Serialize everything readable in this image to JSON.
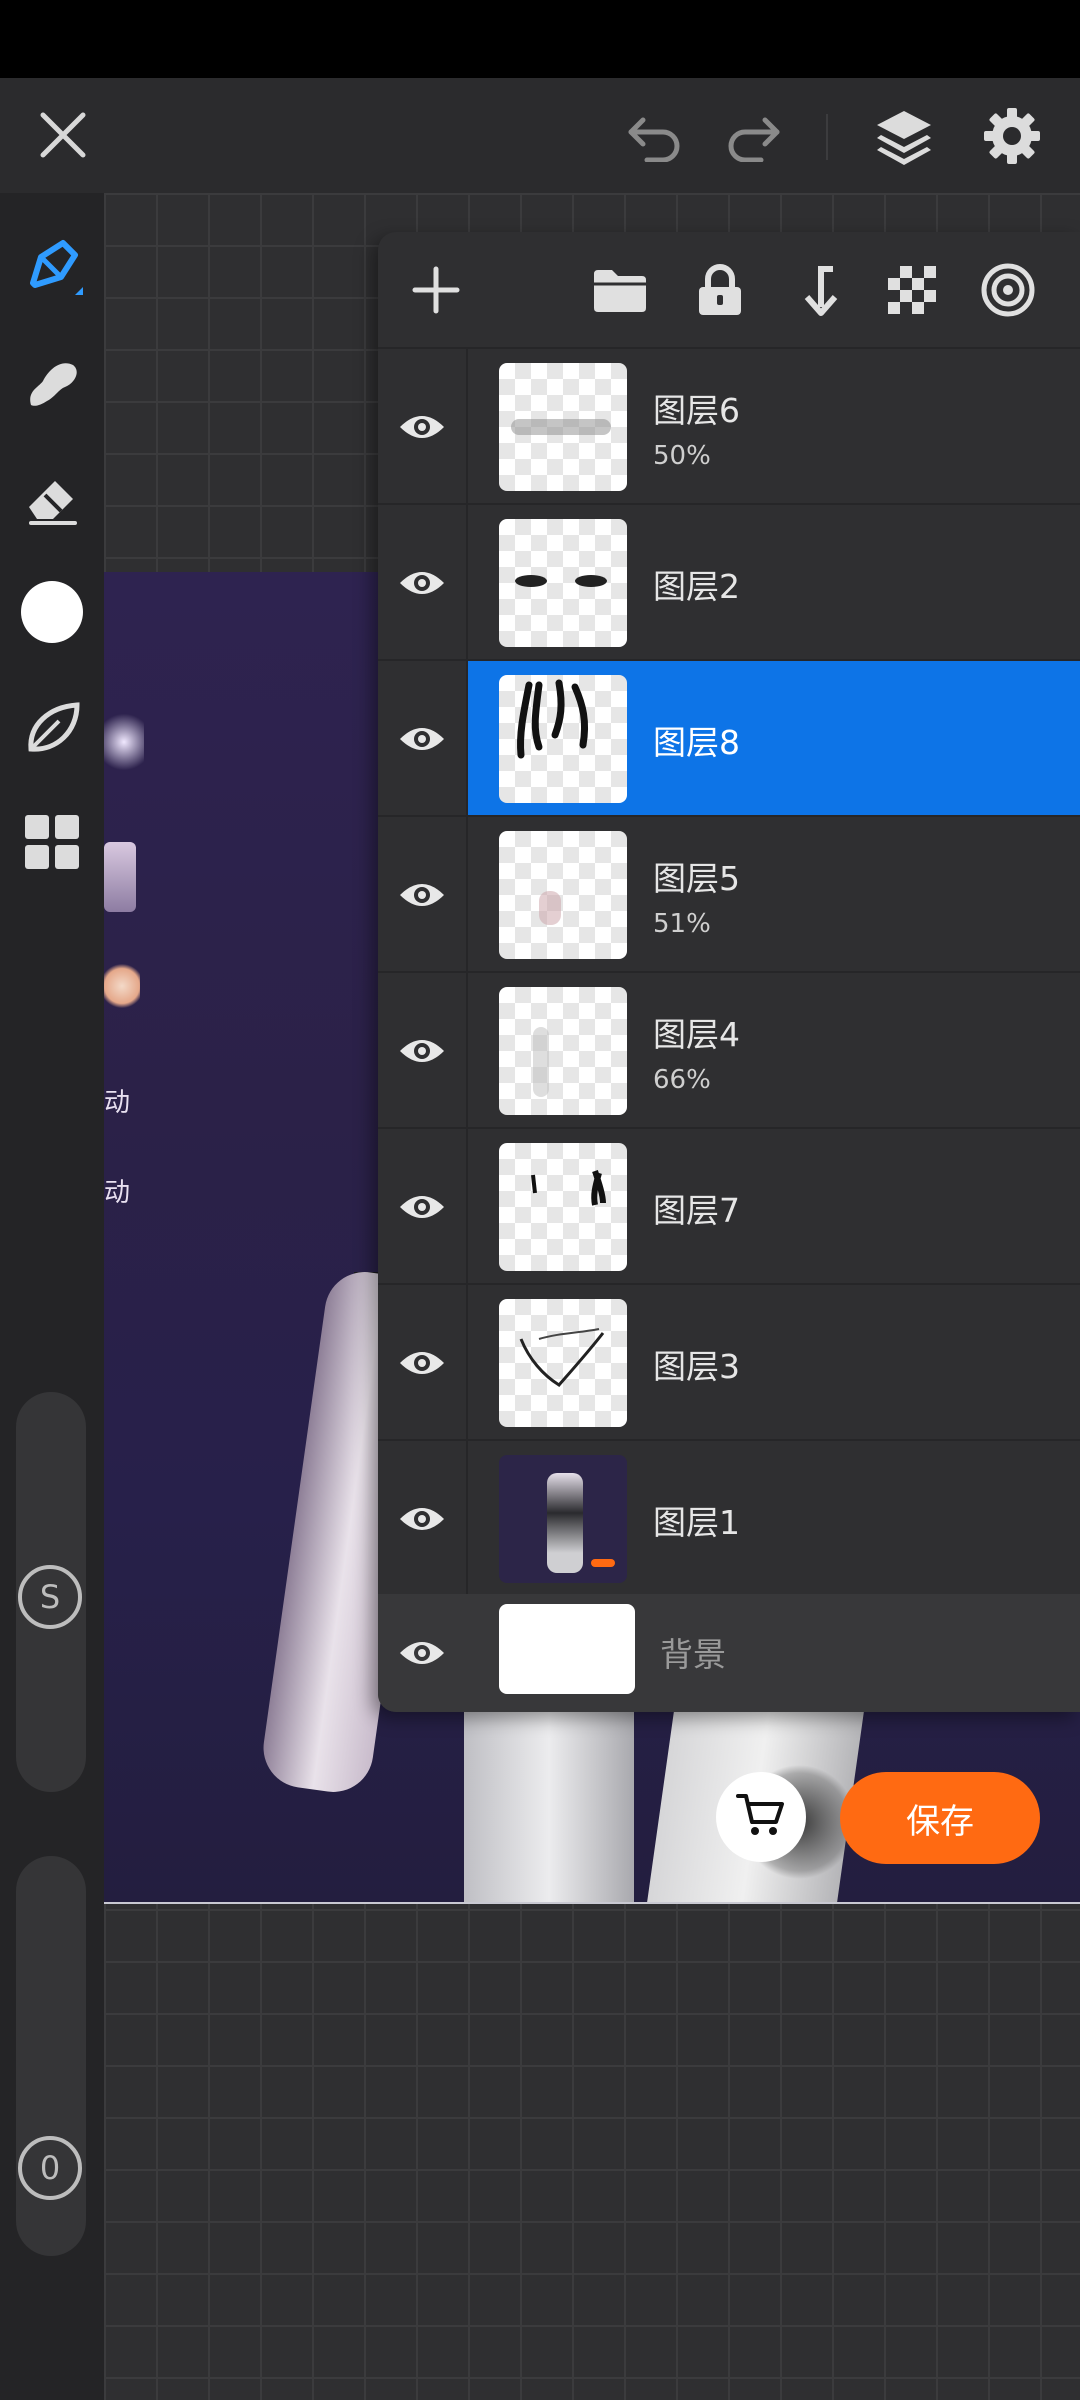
{
  "layers_panel": {
    "layers": [
      {
        "name": "图层6",
        "opacity": "50%"
      },
      {
        "name": "图层2",
        "opacity": ""
      },
      {
        "name": "图层8",
        "opacity": "",
        "selected": true
      },
      {
        "name": "图层5",
        "opacity": "51%"
      },
      {
        "name": "图层4",
        "opacity": "66%"
      },
      {
        "name": "图层7",
        "opacity": ""
      },
      {
        "name": "图层3",
        "opacity": ""
      },
      {
        "name": "图层1",
        "opacity": ""
      }
    ],
    "background_label": "背景"
  },
  "left_toolbar": {
    "size_slider_label": "S",
    "opacity_slider_label": "0"
  },
  "artwork": {
    "text_1": "动",
    "text_2": "动"
  },
  "save_label": "保存",
  "colors": {
    "accent": "#0d74e7",
    "save": "#ff6a12",
    "brush_active": "#2f9bff"
  },
  "icons": [
    "close-icon",
    "undo-icon",
    "redo-icon",
    "layers-icon",
    "settings-icon",
    "brush-icon",
    "smudge-icon",
    "eraser-icon",
    "color-swatch-icon",
    "leaf-icon",
    "grid-icon",
    "add-icon",
    "folder-icon",
    "lock-icon",
    "merge-down-icon",
    "transparency-icon",
    "target-icon",
    "eye-icon",
    "cart-icon"
  ]
}
